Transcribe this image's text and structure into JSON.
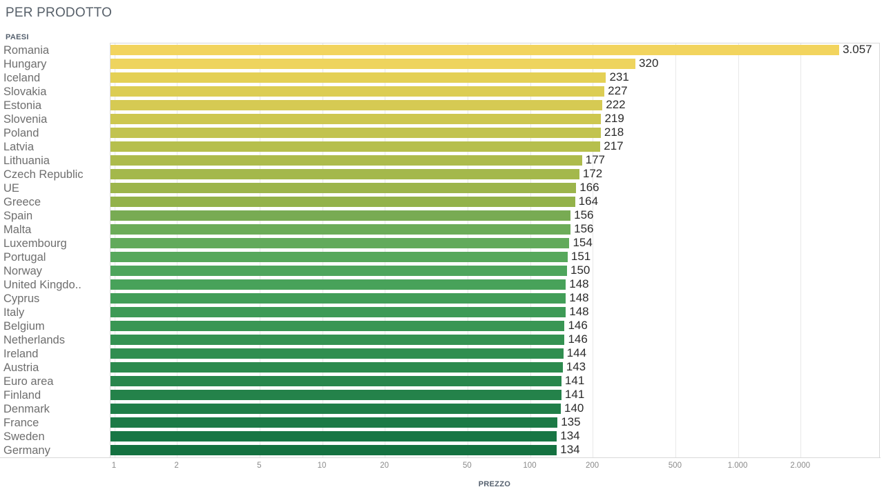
{
  "header": {
    "title": "PER PRODOTTO",
    "dimension_label": "PAESI"
  },
  "axis": {
    "title": "PREZZO",
    "tick_labels": [
      "1",
      "2",
      "5",
      "10",
      "20",
      "50",
      "100",
      "200",
      "500",
      "1.000",
      "2.000"
    ],
    "tick_values": [
      1,
      2,
      5,
      10,
      20,
      50,
      100,
      200,
      500,
      1000,
      2000
    ],
    "scale": "log"
  },
  "chart_data": {
    "type": "bar",
    "orientation": "horizontal",
    "title": "PER PRODOTTO",
    "xlabel": "PREZZO",
    "ylabel": "PAESI",
    "xscale": "log",
    "xlim": [
      1,
      3300
    ],
    "grid": true,
    "legend": false,
    "categories": [
      "Romania",
      "Hungary",
      "Iceland",
      "Slovakia",
      "Estonia",
      "Slovenia",
      "Poland",
      "Latvia",
      "Lithuania",
      "Czech Republic",
      "UE",
      "Greece",
      "Spain",
      "Malta",
      "Luxembourg",
      "Portugal",
      "Norway",
      "United Kingdo..",
      "Cyprus",
      "Italy",
      "Belgium",
      "Netherlands",
      "Ireland",
      "Austria",
      "Euro area",
      "Finland",
      "Denmark",
      "France",
      "Sweden",
      "Germany"
    ],
    "values": [
      3057,
      320,
      231,
      227,
      222,
      219,
      218,
      217,
      177,
      172,
      166,
      164,
      156,
      156,
      154,
      151,
      150,
      148,
      148,
      148,
      146,
      146,
      144,
      143,
      141,
      141,
      140,
      135,
      134,
      134
    ],
    "value_labels": [
      "3.057",
      "320",
      "231",
      "227",
      "222",
      "219",
      "218",
      "217",
      "177",
      "172",
      "166",
      "164",
      "156",
      "156",
      "154",
      "151",
      "150",
      "148",
      "148",
      "148",
      "146",
      "146",
      "144",
      "143",
      "141",
      "141",
      "140",
      "135",
      "134",
      "134"
    ],
    "bar_colors": [
      "#f2d45e",
      "#eed45e",
      "#e4d055",
      "#dccd54",
      "#d6ca53",
      "#cdc750",
      "#c2c34f",
      "#b6bf4d",
      "#adbb4c",
      "#a4b84b",
      "#9cb54b",
      "#93b24a",
      "#78ab53",
      "#6cac59",
      "#62aa5b",
      "#57a85c",
      "#4ea55c",
      "#48a25a",
      "#429e58",
      "#3d9a56",
      "#399654",
      "#349252",
      "#308e50",
      "#2c8a4e",
      "#28864c",
      "#24824a",
      "#207e48",
      "#1c7a46",
      "#187644",
      "#147140"
    ]
  }
}
